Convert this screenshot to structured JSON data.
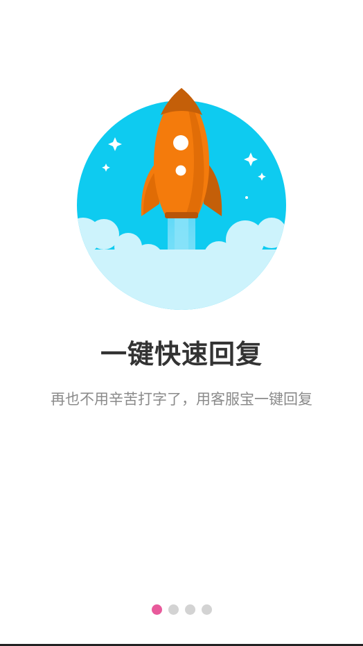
{
  "onboarding": {
    "title": "一键快速回复",
    "subtitle": "再也不用辛苦打字了，用客服宝一键回复",
    "current_page": 1,
    "page_count": 4
  },
  "illustration": {
    "icon": "rocket-icon",
    "colors": {
      "sky": "#0ecbf0",
      "cloud": "#cdf3fc",
      "rocket_body": "#f47b0c",
      "rocket_shadow": "#c45f09",
      "exhaust": "#5fd8f7"
    }
  },
  "pager": {
    "active_color": "#e85a9b",
    "inactive_color": "#d3d3d3"
  }
}
